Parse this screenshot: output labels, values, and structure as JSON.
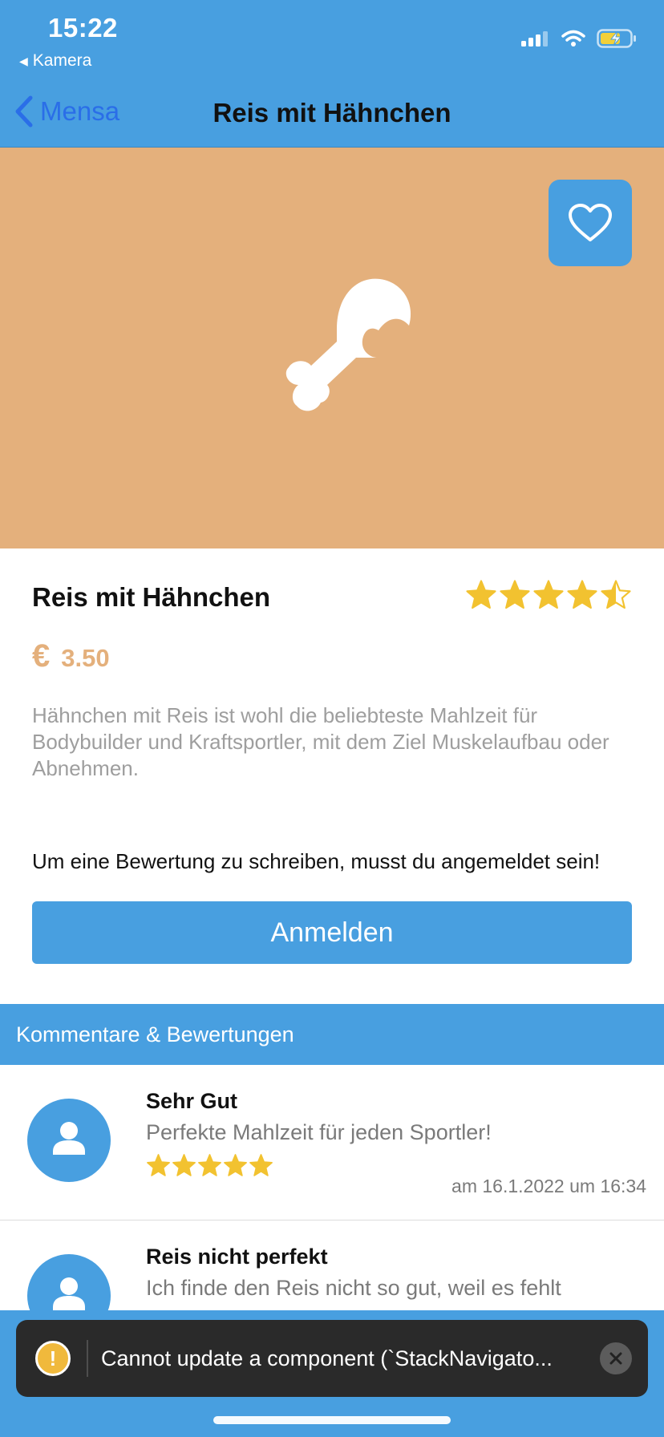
{
  "status_bar": {
    "time": "15:22",
    "back_app": "Kamera",
    "icons": [
      "cellular-signal-icon",
      "wifi-icon",
      "battery-charging-icon"
    ]
  },
  "nav": {
    "back_label": "Mensa",
    "title": "Reis mit Hähnchen"
  },
  "hero": {
    "favorite_icon": "heart-outline-icon",
    "food_icon": "drumstick-icon",
    "background_color": "#e4b07c"
  },
  "dish": {
    "name": "Reis mit Hähnchen",
    "rating": 4.5,
    "rating_max": 5,
    "currency": "€",
    "price": "3.50",
    "description": "Hähnchen mit Reis ist wohl die beliebteste Mahlzeit für Bodybuilder und Kraftsportler, mit dem Ziel Muskelaufbau oder Abnehmen."
  },
  "login": {
    "hint": "Um eine Bewertung zu schreiben, musst du angemeldet sein!",
    "button_label": "Anmelden"
  },
  "comments_section": {
    "header": "Kommentare & Bewertungen",
    "items": [
      {
        "title": "Sehr Gut",
        "text": "Perfekte Mahlzeit für jeden Sportler!",
        "rating": 5,
        "date": "am 16.1.2022 um 16:34"
      },
      {
        "title": "Reis nicht perfekt",
        "text": "Ich finde den Reis nicht so gut, weil es fehlt",
        "rating": 0,
        "date": ""
      }
    ]
  },
  "toast": {
    "message": "Cannot update a component (`StackNavigato..."
  },
  "colors": {
    "primary": "#489fe0",
    "accent": "#e4b07c",
    "star": "#f2c230"
  }
}
